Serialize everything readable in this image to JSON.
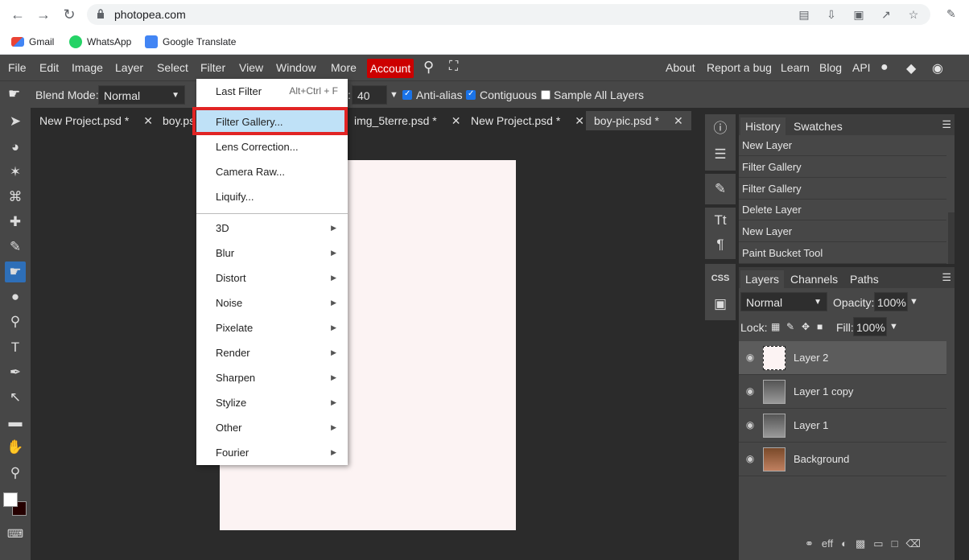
{
  "browser": {
    "url": "photopea.com",
    "bookmarks": [
      "Gmail",
      "WhatsApp",
      "Google Translate"
    ]
  },
  "menubar": {
    "items": [
      "File",
      "Edit",
      "Image",
      "Layer",
      "Select",
      "Filter",
      "View",
      "Window",
      "More"
    ],
    "account": "Account",
    "right_links": [
      "About",
      "Report a bug",
      "Learn",
      "Blog",
      "API"
    ]
  },
  "options": {
    "blend_label": "Blend Mode:",
    "blend_value": "Normal",
    "tolerance_value": "40",
    "tolerance_suffix": ":",
    "anti_alias": "Anti-alias",
    "contiguous": "Contiguous",
    "sample_all": "Sample All Layers"
  },
  "tabs": [
    {
      "label": "New Project.psd *"
    },
    {
      "label": "boy.ps"
    },
    {
      "label": "img_5terre.psd *"
    },
    {
      "label": "New Project.psd *"
    },
    {
      "label": "boy-pic.psd *"
    }
  ],
  "filter_menu": {
    "last_filter": "Last Filter",
    "last_filter_shortcut": "Alt+Ctrl + F",
    "items": [
      "Filter Gallery...",
      "Lens Correction...",
      "Camera Raw...",
      "Liquify..."
    ],
    "submenus": [
      "3D",
      "Blur",
      "Distort",
      "Noise",
      "Pixelate",
      "Render",
      "Sharpen",
      "Stylize",
      "Other",
      "Fourier"
    ]
  },
  "history_panel": {
    "tabs": [
      "History",
      "Swatches"
    ],
    "rows": [
      "New Layer",
      "Filter Gallery",
      "Filter Gallery",
      "Delete Layer",
      "New Layer",
      "Paint Bucket Tool"
    ]
  },
  "layers_panel": {
    "tabs": [
      "Layers",
      "Channels",
      "Paths"
    ],
    "blend": "Normal",
    "opacity_label": "Opacity:",
    "opacity_value": "100%",
    "lock_label": "Lock:",
    "fill_label": "Fill:",
    "fill_value": "100%",
    "layers": [
      "Layer 2",
      "Layer 1 copy",
      "Layer 1",
      "Background"
    ]
  },
  "bottom_icons": [
    "link-icon",
    "effects-icon",
    "adjustment-icon",
    "mask-icon",
    "folder-icon",
    "new-layer-icon",
    "delete-icon"
  ],
  "colors": {
    "account_red": "#cc0000",
    "highlight_blue": "#bfe1f7",
    "outline_red": "#e12424"
  }
}
